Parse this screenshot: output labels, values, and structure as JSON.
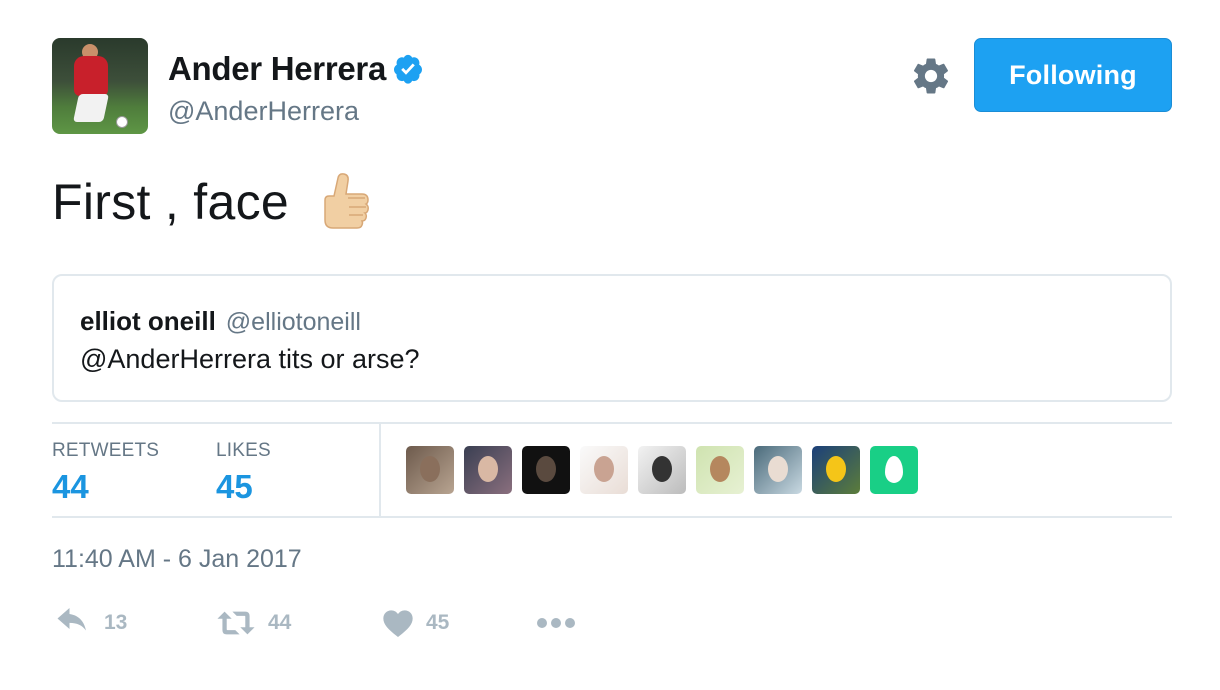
{
  "author": {
    "name": "Ander Herrera",
    "handle": "@AnderHerrera",
    "verified": true,
    "avatar_icon": "avatar"
  },
  "header": {
    "settings_icon": "gear-icon",
    "follow_button_label": "Following"
  },
  "tweet": {
    "text": "First , face",
    "emoji": "thumbs-up-icon"
  },
  "quoted_tweet": {
    "name": "elliot oneill",
    "handle": "@elliotoneill",
    "text": "@AnderHerrera tits or arse?"
  },
  "stats": {
    "retweets_label": "RETWEETS",
    "retweets_value": "44",
    "likes_label": "LIKES",
    "likes_value": "45"
  },
  "likers_count_shown": 9,
  "timestamp": "11:40 AM - 6 Jan 2017",
  "actions": {
    "reply_count": "13",
    "retweet_count": "44",
    "like_count": "45"
  },
  "colors": {
    "brand_blue": "#1da1f2",
    "link_blue": "#1b95e0",
    "muted_gray": "#657786",
    "icon_gray": "#aab8c2",
    "border": "#e1e8ed"
  }
}
